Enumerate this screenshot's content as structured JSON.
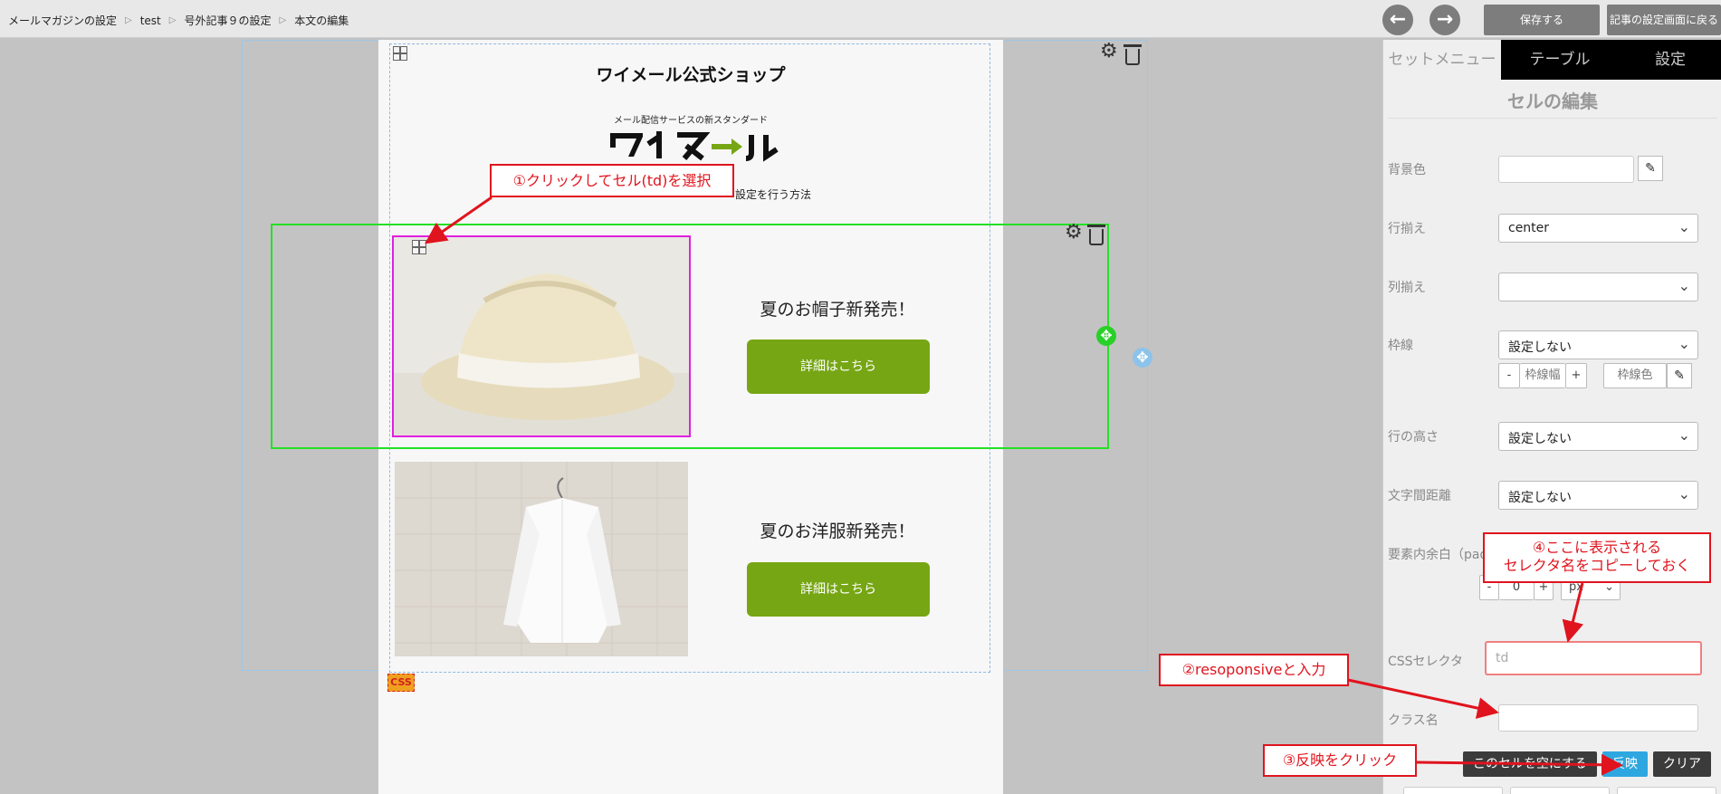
{
  "breadcrumb": [
    "メールマガジンの設定",
    "test",
    "号外記事９の設定",
    "本文の編集"
  ],
  "toolbar": {
    "back_icon": "arrow-left-icon",
    "forward_icon": "arrow-right-icon",
    "save_label": "保存する",
    "return_label": "記事の設定画面に戻る"
  },
  "email": {
    "shop_title": "ワイメール公式ショップ",
    "tagline": "メール配信サービスの新スタンダード",
    "logo_text": "ワイメール",
    "method_text": "設定を行う方法",
    "products": [
      {
        "title": "夏のお帽子新発売！",
        "button": "詳細はこちら"
      },
      {
        "title": "夏のお洋服新発売！",
        "button": "詳細はこちら"
      }
    ],
    "css_tag": "CSS"
  },
  "panel": {
    "tabs": [
      "セットメニュー",
      "テーブル",
      "設定"
    ],
    "title": "セルの編集",
    "bg_label": "背景色",
    "halign_label": "行揃え",
    "halign_value": "center",
    "valign_label": "列揃え",
    "valign_value": "",
    "border_label": "枠線",
    "border_value": "設定しない",
    "border_minus": "-",
    "border_width_label": "枠線幅",
    "border_plus": "+",
    "border_color_label": "枠線色",
    "row_height_label": "行の高さ",
    "row_height_value": "設定しない",
    "letter_spacing_label": "文字間距離",
    "letter_spacing_value": "設定しない",
    "padding_label": "要素内余白（pad",
    "padding_minus": "-",
    "padding_value": "0",
    "padding_plus": "+",
    "padding_unit": "px",
    "css_selector_label": "CSSセレクタ",
    "css_selector_value": "td",
    "class_label": "クラス名",
    "class_value": "",
    "clear_cell_label": "このセルを空にする",
    "apply_label": "反映",
    "clear_label": "クリア"
  },
  "annotations": {
    "step1": "①クリックしてセル(td)を選択",
    "step2": "②resoponsiveと入力",
    "step3": "③反映をクリック",
    "step4_line1": "④ここに表示される",
    "step4_line2": "セレクタ名をコピーしておく"
  },
  "colors": {
    "accent_green": "#76a614",
    "annotation_red": "#e0141e",
    "row_select": "#25e025",
    "cell_select": "#e020e0",
    "apply_blue": "#2ea7e0"
  }
}
